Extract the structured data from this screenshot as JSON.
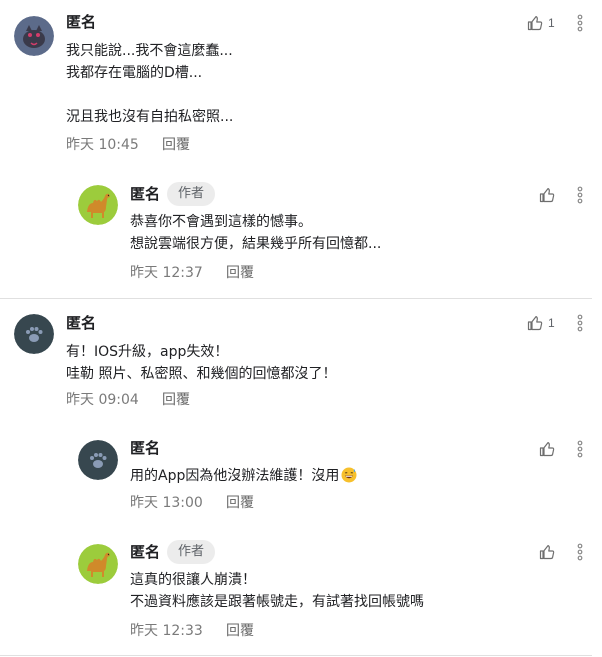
{
  "comments": [
    {
      "author": "匿名",
      "body": [
        "我只能說...我不會這麼蠢...",
        "我都存在電腦的D槽...",
        "",
        "況且我也沒有自拍私密照..."
      ],
      "time": "昨天 10:45",
      "reply_label": "回覆",
      "like_count": "1",
      "avatar": "cat-avatar"
    },
    {
      "author": "匿名",
      "badge": "作者",
      "body": [
        "恭喜你不會遇到這樣的憾事。",
        "想說雲端很方便，結果幾乎所有回憶都..."
      ],
      "time": "昨天 12:37",
      "reply_label": "回覆",
      "avatar": "camel-avatar"
    },
    {
      "author": "匿名",
      "body": [
        "有！IOS升級，app失效！",
        "哇勒 照片、私密照、和幾個的回憶都沒了！"
      ],
      "time": "昨天 09:04",
      "reply_label": "回覆",
      "like_count": "1",
      "avatar": "paw-avatar"
    },
    {
      "author": "匿名",
      "body": [
        "用的App因為他沒辦法維護！沒用"
      ],
      "emoji": "grinning-sweat-emoji",
      "time": "昨天 13:00",
      "reply_label": "回覆",
      "avatar": "paw-avatar"
    },
    {
      "author": "匿名",
      "badge": "作者",
      "body": [
        "這真的很讓人崩潰！",
        "不過資料應該是跟著帳號走，有試著找回帳號嗎"
      ],
      "time": "昨天 12:33",
      "reply_label": "回覆",
      "avatar": "camel-avatar"
    }
  ],
  "colors": {
    "camel_bg": "#9ccc3c",
    "paw_bg": "#37474f",
    "cat_bg": "#5c6b8a",
    "divider": "#e0e0e0"
  }
}
